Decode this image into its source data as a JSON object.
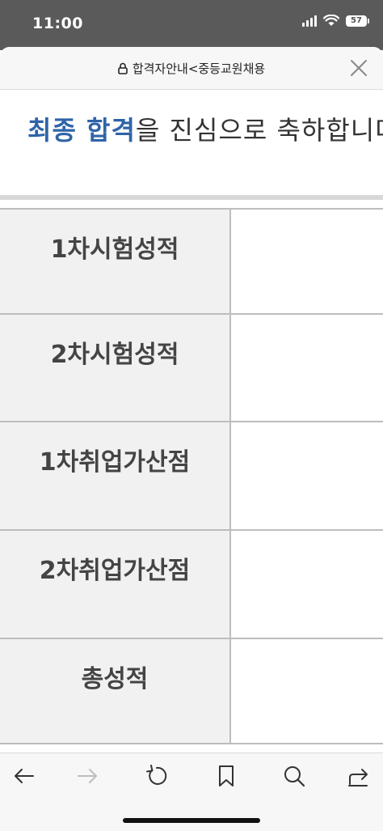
{
  "status_bar": {
    "time": "11:00",
    "battery": "57"
  },
  "header": {
    "title": "합격자안내<중등교원채용"
  },
  "message": {
    "highlight": "최종 합격",
    "rest": "을 진심으로 축하합니다"
  },
  "table": {
    "rows": [
      {
        "label": "1차시험성적",
        "value": ""
      },
      {
        "label": "2차시험성적",
        "value": ""
      },
      {
        "label": "1차취업가산점",
        "value": ""
      },
      {
        "label": "2차취업가산점",
        "value": ""
      },
      {
        "label": "총성적",
        "value": ""
      }
    ]
  },
  "colors": {
    "accent": "#2f64a8",
    "status_bar": "#5a5a5a"
  }
}
